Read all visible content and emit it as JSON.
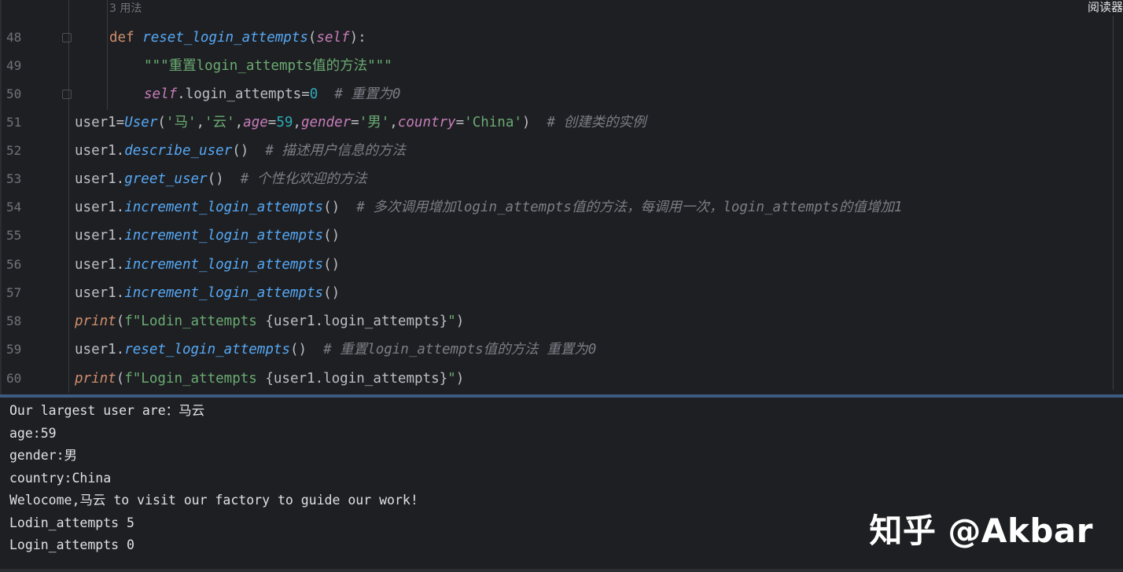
{
  "editor": {
    "hint": "3 用法",
    "reader_mode": "阅读器",
    "lines": [
      {
        "no": "48"
      },
      {
        "no": "49"
      },
      {
        "no": "50"
      },
      {
        "no": "51"
      },
      {
        "no": "52"
      },
      {
        "no": "53"
      },
      {
        "no": "54"
      },
      {
        "no": "55"
      },
      {
        "no": "56"
      },
      {
        "no": "57"
      },
      {
        "no": "58"
      },
      {
        "no": "59"
      },
      {
        "no": "60"
      }
    ],
    "code": {
      "l48": {
        "def": "def",
        "name": "reset_login_attempts",
        "open": "(",
        "self": "self",
        "close": "):"
      },
      "l49": {
        "doc": "\"\"\"重置login_attempts值的方法\"\"\""
      },
      "l50": {
        "self": "self",
        "attr": ".login_attempts=",
        "val": "0",
        "comment": "  # 重置为0"
      },
      "l51": {
        "var": "user1=",
        "cls": "User",
        "p1": "(",
        "s1": "'马'",
        "c1": ",",
        "s2": "'云'",
        "c2": ",",
        "k1": "age",
        "e1": "=",
        "n1": "59",
        "c3": ",",
        "k2": "gender",
        "e2": "=",
        "s3": "'男'",
        "c4": ",",
        "k3": "country",
        "e3": "=",
        "s4": "'China'",
        "p2": ")",
        "comment": "  # 创建类的实例"
      },
      "l52": {
        "obj": "user1.",
        "m": "describe_user",
        "args": "()",
        "comment": "  # 描述用户信息的方法"
      },
      "l53": {
        "obj": "user1.",
        "m": "greet_user",
        "args": "()",
        "comment": "  # 个性化欢迎的方法"
      },
      "l54": {
        "obj": "user1.",
        "m": "increment_login_attempts",
        "args": "()",
        "comment": "  # 多次调用增加login_attempts值的方法，每调用一次，login_attempts的值增加1"
      },
      "l55": {
        "obj": "user1.",
        "m": "increment_login_attempts",
        "args": "()"
      },
      "l56": {
        "obj": "user1.",
        "m": "increment_login_attempts",
        "args": "()"
      },
      "l57": {
        "obj": "user1.",
        "m": "increment_login_attempts",
        "args": "()"
      },
      "l58": {
        "fn": "print",
        "open": "(",
        "str": "f\"Lodin_attempts ",
        "expr": "{user1.login_attempts}",
        "end": "\"",
        "close": ")"
      },
      "l59": {
        "obj": "user1.",
        "m": "reset_login_attempts",
        "args": "()",
        "comment": "  # 重置login_attempts值的方法 重置为0"
      },
      "l60": {
        "fn": "print",
        "open": "(",
        "str": "f\"Login_attempts ",
        "expr": "{user1.login_attempts}",
        "end": "\"",
        "close": ")"
      }
    }
  },
  "console": {
    "output": [
      "Our largest user are：马云",
      "age:59",
      "gender:男",
      "country:China",
      "Welocome,马云 to visit our factory to guide our work!",
      "Lodin_attempts 5",
      "Login_attempts 0"
    ]
  },
  "watermark": "知乎 @Akbar"
}
